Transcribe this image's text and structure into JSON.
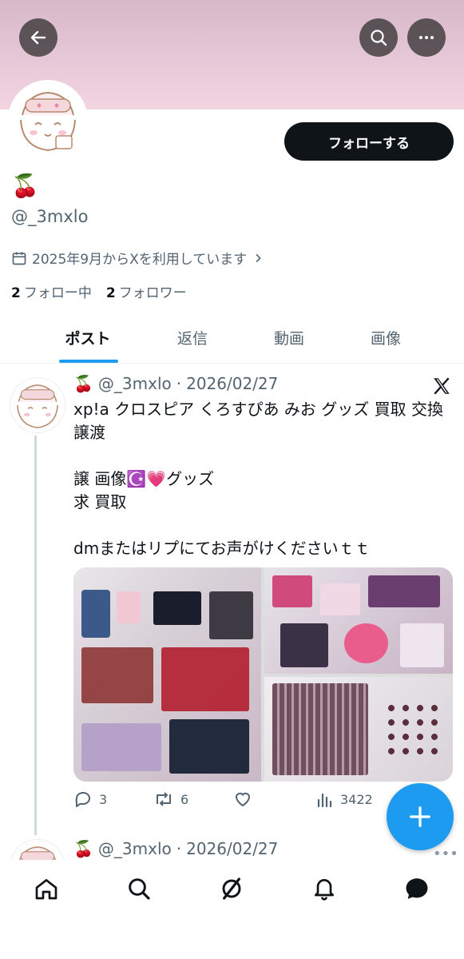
{
  "header": {
    "back_icon": "arrow-left-icon",
    "search_icon": "search-icon",
    "more_icon": "more-horizontal-icon",
    "banner_color": "#e8c9d8"
  },
  "profile": {
    "display_name": "🍒",
    "handle": "@_3mxlo",
    "joined": "2025年9月からXを利用しています",
    "following_count": "2",
    "following_label": "フォロー中",
    "followers_count": "2",
    "followers_label": "フォロワー",
    "follow_button": "フォローする"
  },
  "tabs": [
    {
      "label": "ポスト",
      "active": true
    },
    {
      "label": "返信",
      "active": false
    },
    {
      "label": "動画",
      "active": false
    },
    {
      "label": "画像",
      "active": false
    }
  ],
  "post": {
    "name": "🍒",
    "handle": "@_3mxlo",
    "date": "2026/02/27",
    "text": "xp!a クロスピア くろすぴあ みお グッズ 買取 交換 譲渡\n\n譲 画像☪️💗グッズ\n求 買取\n\ndmまたはリプにてお声がけくださいｔｔ",
    "replies": "3",
    "reposts": "6",
    "likes": "",
    "views": "3422"
  },
  "post2": {
    "name": "🍒",
    "handle": "@_3mxlo",
    "date": "2026/02/27"
  },
  "nav": [
    "home-icon",
    "search-icon",
    "grok-icon",
    "notifications-icon",
    "messages-icon"
  ],
  "colors": {
    "accent": "#1d9bf0",
    "text": "#0f1419",
    "secondary": "#536471"
  }
}
